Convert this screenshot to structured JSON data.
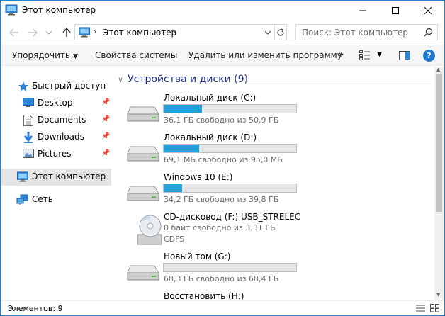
{
  "window": {
    "title": "Этот компьютер"
  },
  "address": {
    "path": "Этот компьютер",
    "search_placeholder": "Поиск: Этот компьютер"
  },
  "toolbar": {
    "organize": "Упорядочить",
    "system_props": "Свойства системы",
    "uninstall": "Удалить или изменить программу",
    "more": "»",
    "help": "?"
  },
  "sidebar": {
    "quick_access": "Быстрый доступ",
    "items": [
      {
        "label": "Desktop",
        "icon": "desktop-icon"
      },
      {
        "label": "Documents",
        "icon": "documents-icon"
      },
      {
        "label": "Downloads",
        "icon": "downloads-icon"
      },
      {
        "label": "Pictures",
        "icon": "pictures-icon"
      }
    ],
    "this_pc": "Этот компьютер",
    "network": "Сеть"
  },
  "content": {
    "group_title": "Устройства и диски (9)",
    "drives": [
      {
        "name": "Локальный диск (C:)",
        "info": "36,1 ГБ свободно из 50,9 ГБ",
        "used_fraction": 0.29
      },
      {
        "name": "Локальный диск (D:)",
        "info": "69,1 МБ свободно из 95,0 МБ",
        "used_fraction": 0.27
      },
      {
        "name": "Windows 10 (E:)",
        "info": "34,2 ГБ свободно из 39,8 ГБ",
        "used_fraction": 0.14
      },
      {
        "name": "CD-дисковод (F:) USB_STRELEC",
        "info": "0 байт свободно из 3,31 ГБ",
        "fs": "CDFS"
      },
      {
        "name": "Новый том (G:)",
        "info": "68,3 ГБ свободно из 68,4 ГБ",
        "used_fraction": 0.0
      },
      {
        "name": "Восстановить (H:)"
      }
    ]
  },
  "status": {
    "count": "Элементов: 9"
  },
  "colors": {
    "accent": "#26a0da",
    "window_border": "#1883d7",
    "group_title": "#1e3287"
  }
}
